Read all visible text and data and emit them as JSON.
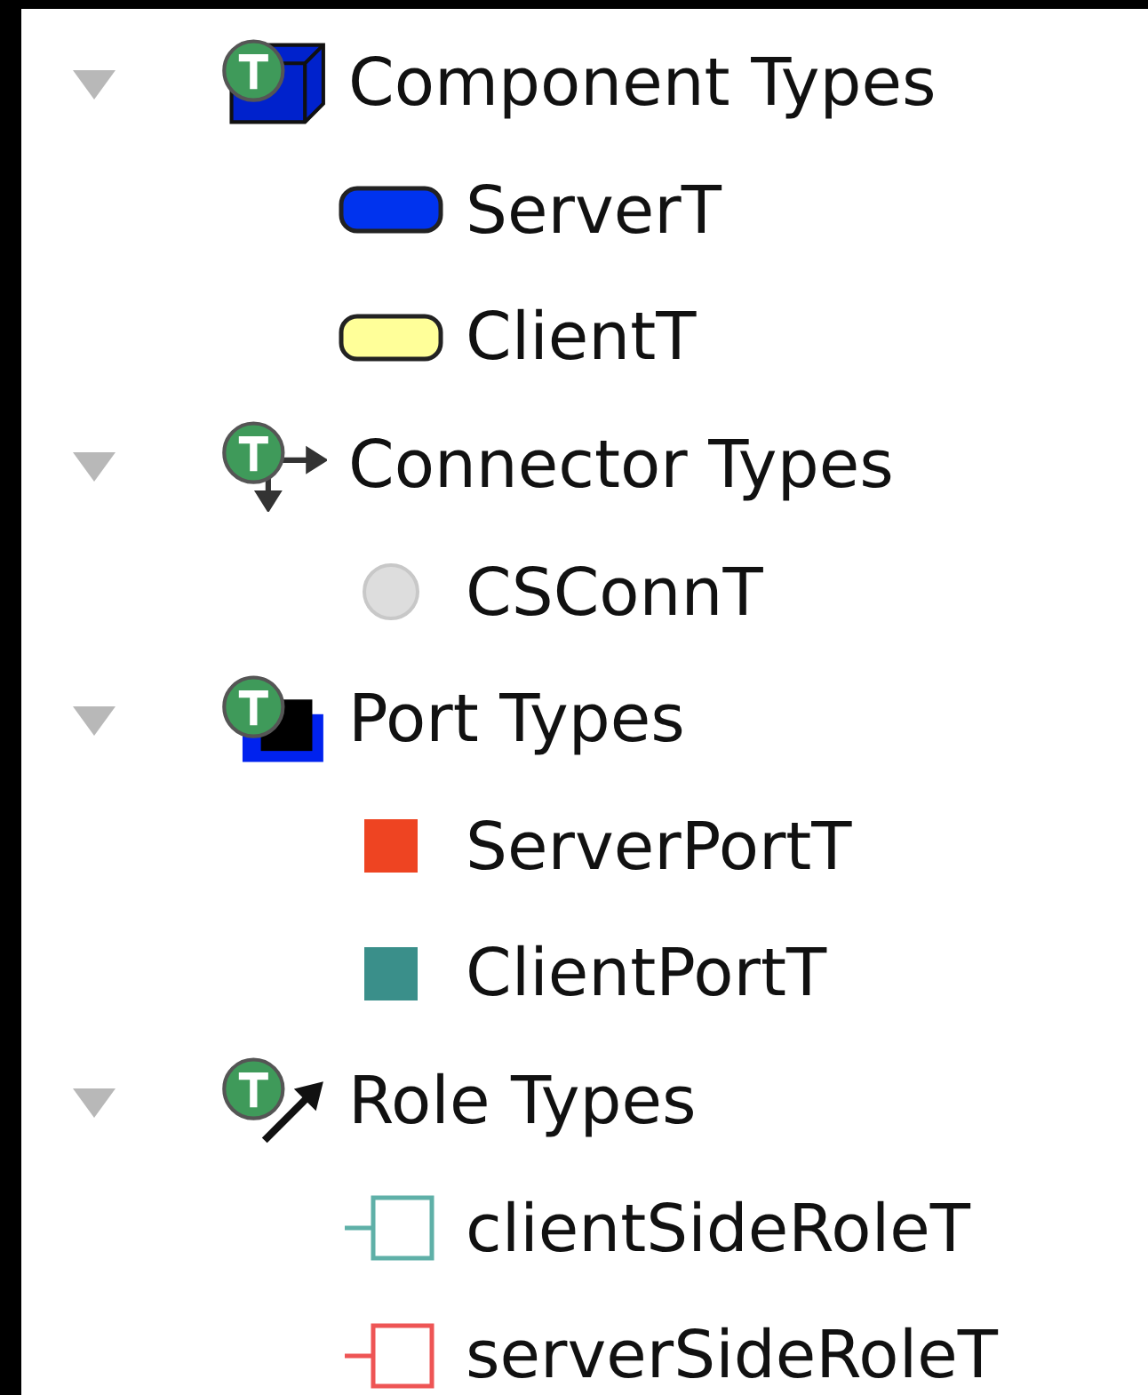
{
  "tree": [
    {
      "label": "Component Types",
      "kind": "component",
      "expanded": true,
      "children": [
        {
          "label": "ServerT",
          "kind": "pill",
          "color": "#0033ee"
        },
        {
          "label": "ClientT",
          "kind": "pill",
          "color": "#ffff99"
        }
      ]
    },
    {
      "label": "Connector Types",
      "kind": "connector",
      "expanded": true,
      "children": [
        {
          "label": "CSConnT",
          "kind": "circle",
          "color": "#dddddd"
        }
      ]
    },
    {
      "label": "Port Types",
      "kind": "port",
      "expanded": true,
      "children": [
        {
          "label": "ServerPortT",
          "kind": "square",
          "color": "#ee4422"
        },
        {
          "label": "ClientPortT",
          "kind": "square",
          "color": "#3a8f8a"
        }
      ]
    },
    {
      "label": "Role Types",
      "kind": "role",
      "expanded": true,
      "children": [
        {
          "label": "clientSideRoleT",
          "kind": "role",
          "color": "#5fb0a8"
        },
        {
          "label": "serverSideRoleT",
          "kind": "role",
          "color": "#ee5555"
        }
      ]
    }
  ]
}
